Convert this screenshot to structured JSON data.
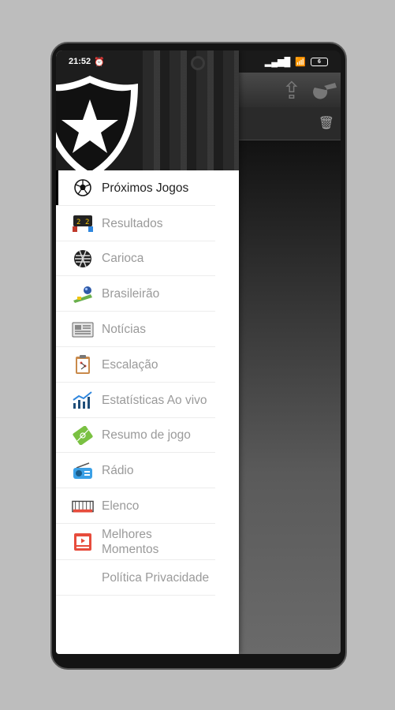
{
  "status": {
    "time": "21:52",
    "battery": "6"
  },
  "menu": {
    "items": [
      {
        "label": "Próximos Jogos",
        "icon": "soccer-ball-icon"
      },
      {
        "label": "Resultados",
        "icon": "scoreboard-icon"
      },
      {
        "label": "Carioca",
        "icon": "carioca-crest-icon"
      },
      {
        "label": "Brasileirão",
        "icon": "brasileirao-trophy-icon"
      },
      {
        "label": "Notícias",
        "icon": "newspaper-icon"
      },
      {
        "label": "Escalação",
        "icon": "clipboard-icon"
      },
      {
        "label": "Estatísticas Ao vivo",
        "icon": "chart-icon"
      },
      {
        "label": "Resumo de jogo",
        "icon": "field-icon"
      },
      {
        "label": "Rádio",
        "icon": "radio-icon"
      },
      {
        "label": "Elenco",
        "icon": "team-icon"
      },
      {
        "label": "Melhores Momentos",
        "icon": "video-play-icon"
      },
      {
        "label": "Política Privacidade",
        "icon": ""
      }
    ]
  },
  "colors": {
    "accent": "#000000",
    "drawer_bg": "#ffffff",
    "inactive_text": "#9a9a9a"
  }
}
